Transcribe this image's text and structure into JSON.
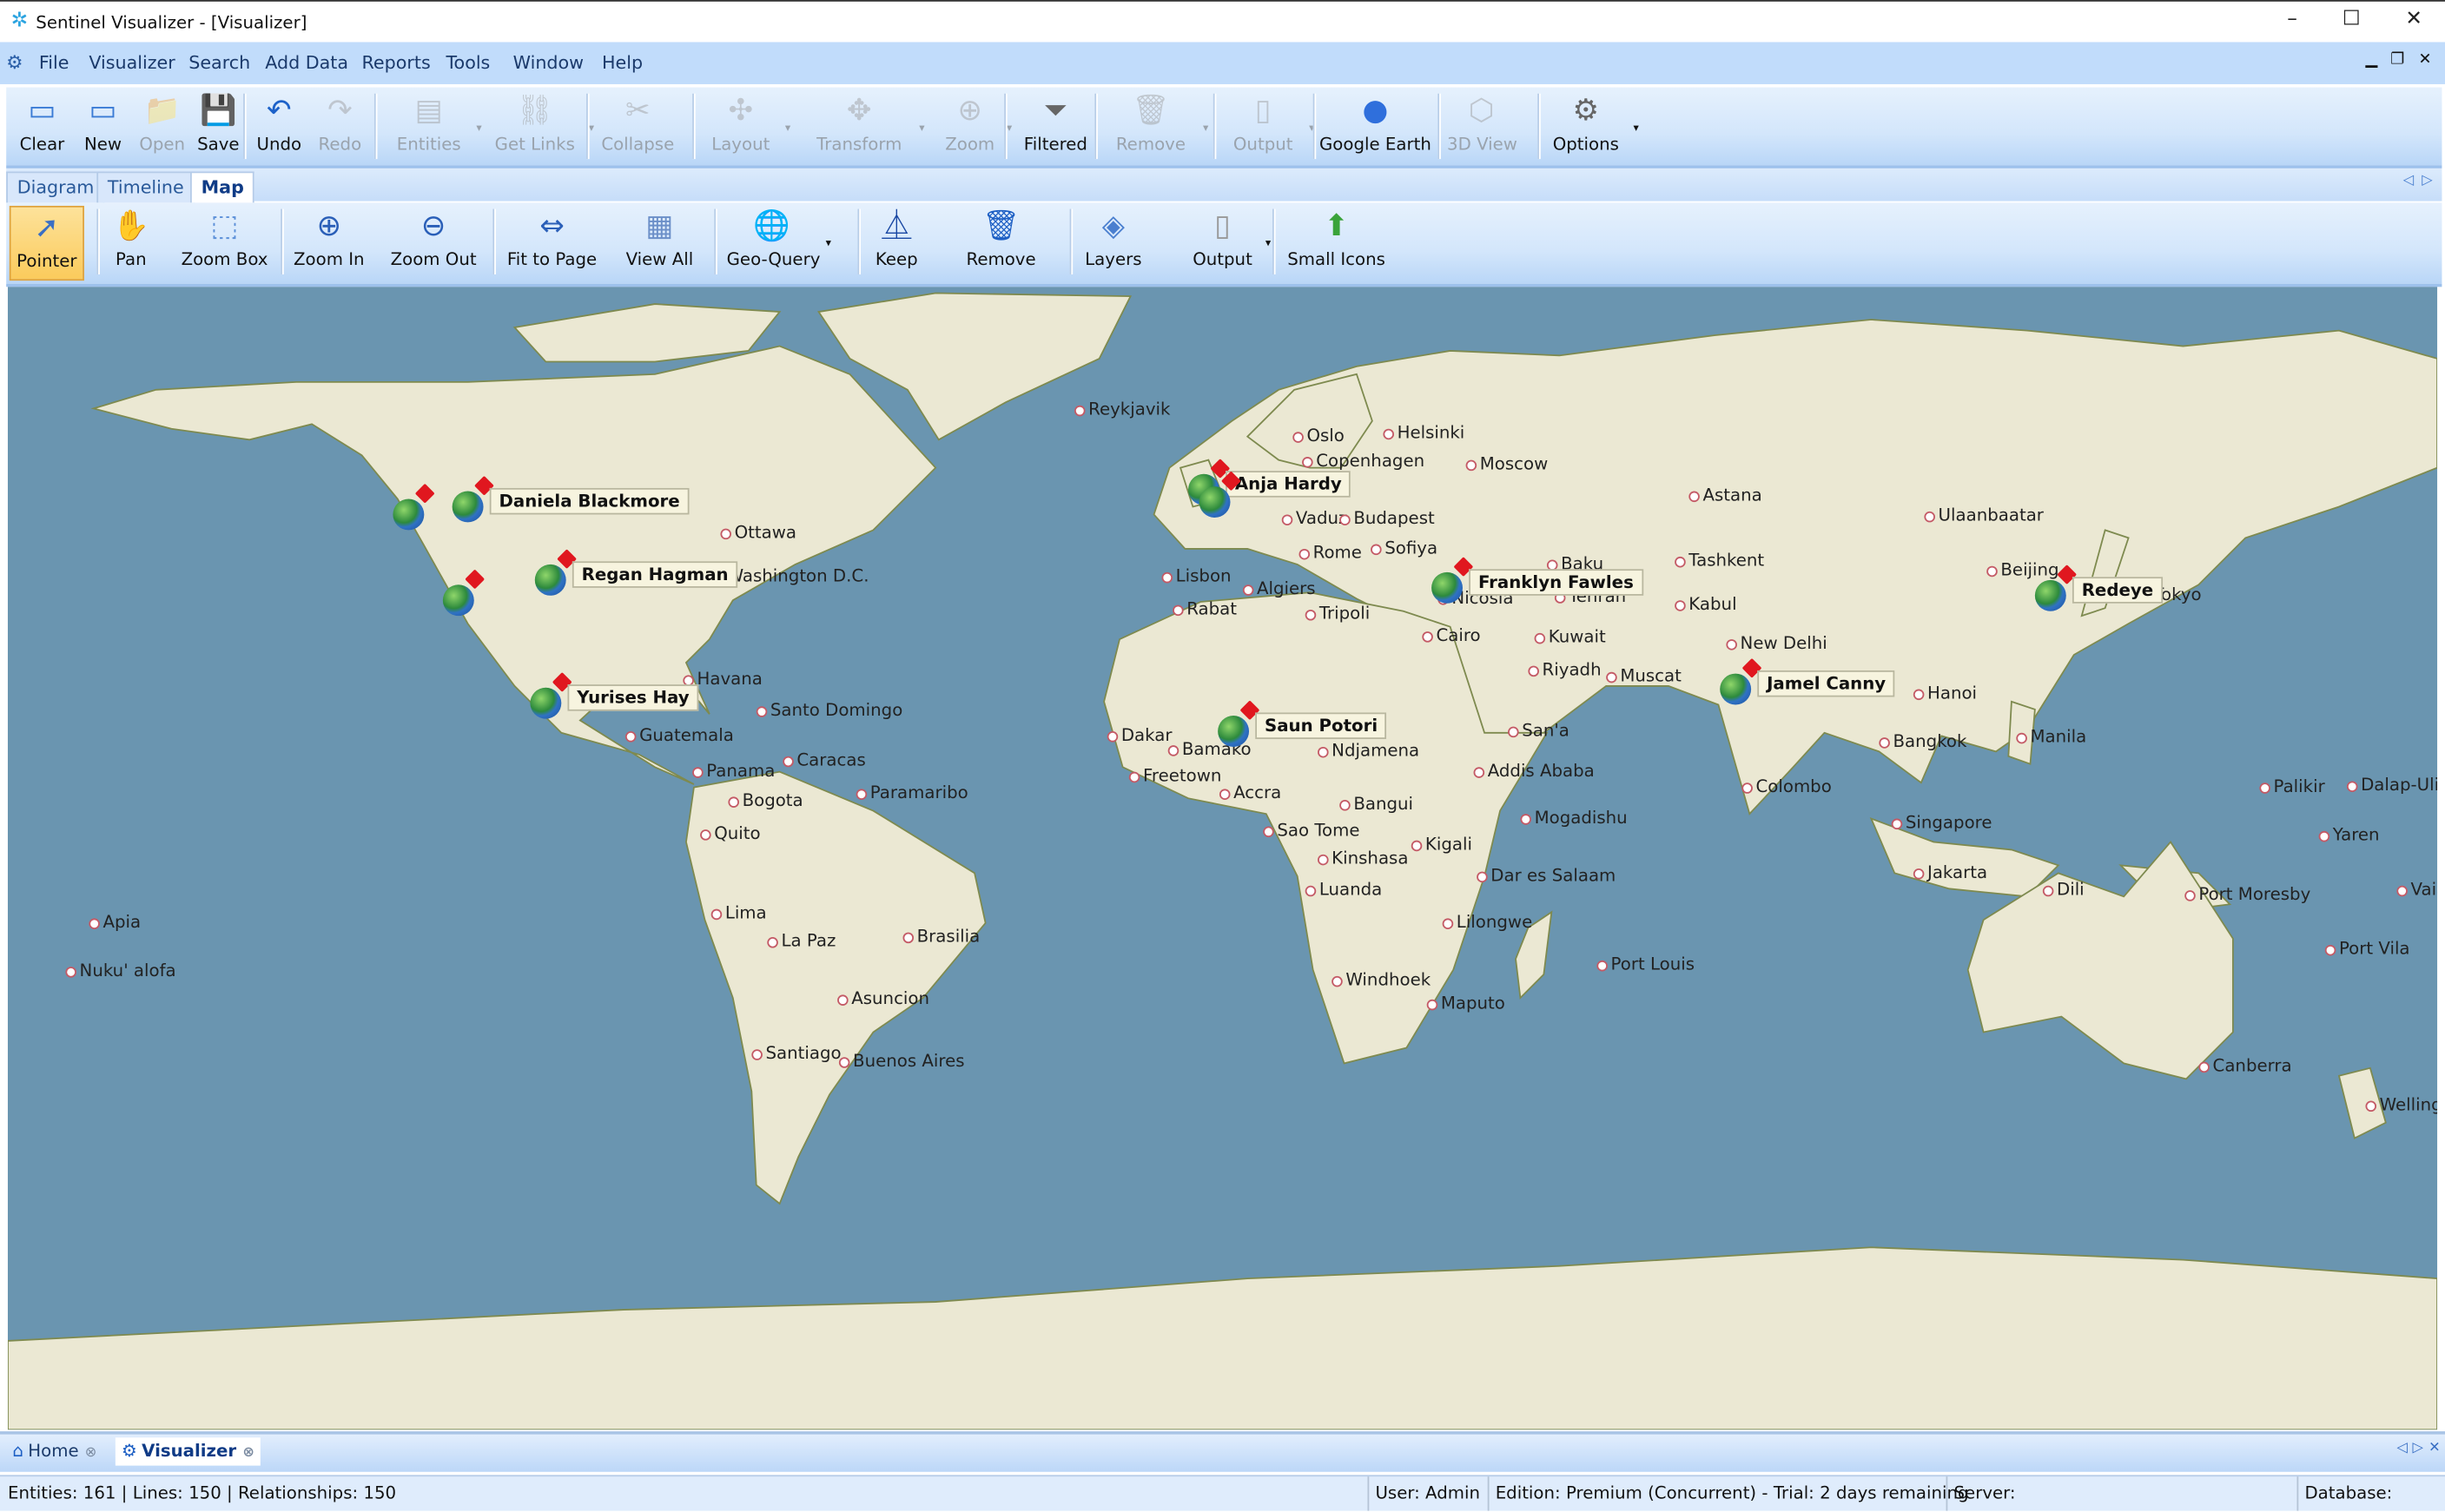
{
  "window": {
    "title": "Sentinel Visualizer - [Visualizer]",
    "app_icon": "sentinel-logo-icon",
    "minimize": "–",
    "maximize": "☐",
    "close": "✕"
  },
  "menu": {
    "items": [
      "File",
      "Visualizer",
      "Search",
      "Add Data",
      "Reports",
      "Tools",
      "Window",
      "Help"
    ],
    "mdi_minimize": "▁",
    "mdi_restore": "❐",
    "mdi_close": "✕"
  },
  "main_toolbar": [
    {
      "label": "Clear",
      "icon": "clear-icon",
      "glyph": "▭",
      "enabled": true,
      "color": "#3a7bd5"
    },
    {
      "label": "New",
      "icon": "new-icon",
      "glyph": "▭",
      "enabled": true,
      "color": "#3a7bd5"
    },
    {
      "label": "Open",
      "icon": "open-folder-icon",
      "glyph": "📁",
      "enabled": false,
      "color": "#999"
    },
    {
      "label": "Save",
      "icon": "save-icon",
      "glyph": "💾",
      "enabled": true,
      "color": "#1746a2"
    },
    {
      "label": "Undo",
      "icon": "undo-icon",
      "glyph": "↶",
      "enabled": true,
      "color": "#1d62c9"
    },
    {
      "label": "Redo",
      "icon": "redo-icon",
      "glyph": "↷",
      "enabled": false,
      "color": "#999"
    },
    {
      "label": "Entities",
      "icon": "entities-icon",
      "glyph": "▤",
      "enabled": false,
      "dropdown": true,
      "color": "#999"
    },
    {
      "label": "Get Links",
      "icon": "get-links-icon",
      "glyph": "⛓",
      "enabled": false,
      "dropdown": true,
      "color": "#999"
    },
    {
      "label": "Collapse",
      "icon": "collapse-icon",
      "glyph": "✂",
      "enabled": false,
      "color": "#999"
    },
    {
      "label": "Layout",
      "icon": "layout-icon",
      "glyph": "✣",
      "enabled": false,
      "dropdown": true,
      "color": "#999"
    },
    {
      "label": "Transform",
      "icon": "transform-icon",
      "glyph": "✥",
      "enabled": false,
      "dropdown": true,
      "color": "#999"
    },
    {
      "label": "Zoom",
      "icon": "zoom-icon",
      "glyph": "⊕",
      "enabled": false,
      "dropdown": true,
      "color": "#999"
    },
    {
      "label": "Filtered",
      "icon": "filter-icon",
      "glyph": "⏷",
      "enabled": true,
      "color": "#666"
    },
    {
      "label": "Remove",
      "icon": "trash-icon",
      "glyph": "🗑",
      "enabled": false,
      "dropdown": true,
      "color": "#999"
    },
    {
      "label": "Output",
      "icon": "output-icon",
      "glyph": "▯",
      "enabled": false,
      "dropdown": true,
      "color": "#999"
    },
    {
      "label": "Google Earth",
      "icon": "google-earth-icon",
      "glyph": "●",
      "enabled": true,
      "color": "#2f6fdc"
    },
    {
      "label": "3D View",
      "icon": "cube-icon",
      "glyph": "⬡",
      "enabled": false,
      "color": "#999"
    },
    {
      "label": "Options",
      "icon": "gear-icon",
      "glyph": "⚙",
      "enabled": true,
      "dropdown": true,
      "color": "#666"
    }
  ],
  "view_tabs": [
    {
      "label": "Diagram",
      "selected": false
    },
    {
      "label": "Timeline",
      "selected": false
    },
    {
      "label": "Map",
      "selected": true
    }
  ],
  "tab_scroll": {
    "left": "◁",
    "right": "▷"
  },
  "map_toolbar": [
    {
      "label": "Pointer",
      "icon": "pointer-icon",
      "glyph": "➚",
      "active": true,
      "color": "#3a6fc4"
    },
    {
      "label": "Pan",
      "icon": "hand-icon",
      "glyph": "✋",
      "color": "#2e5fb0"
    },
    {
      "label": "Zoom Box",
      "icon": "zoom-box-icon",
      "glyph": "⬚",
      "color": "#5b8fd8"
    },
    {
      "label": "Zoom In",
      "icon": "zoom-in-icon",
      "glyph": "⊕",
      "color": "#2a5fb8"
    },
    {
      "label": "Zoom Out",
      "icon": "zoom-out-icon",
      "glyph": "⊖",
      "color": "#2a5fb8"
    },
    {
      "label": "Fit to Page",
      "icon": "fit-to-page-icon",
      "glyph": "⇔",
      "color": "#2a5fb8"
    },
    {
      "label": "View All",
      "icon": "view-all-icon",
      "glyph": "▦",
      "color": "#6b8fc8"
    },
    {
      "label": "Geo-Query",
      "icon": "globe-icon",
      "glyph": "🌐",
      "dropdown": true,
      "color": "#2a5fb8"
    },
    {
      "label": "Keep",
      "icon": "keep-icon",
      "glyph": "⏅",
      "color": "#1746a2"
    },
    {
      "label": "Remove",
      "icon": "trash-icon",
      "glyph": "🗑",
      "color": "#1d5fc4"
    },
    {
      "label": "Layers",
      "icon": "layers-icon",
      "glyph": "◈",
      "color": "#4a7fcf"
    },
    {
      "label": "Output",
      "icon": "output-icon",
      "glyph": "▯",
      "dropdown": true,
      "color": "#999"
    },
    {
      "label": "Small Icons",
      "icon": "small-icons-icon",
      "glyph": "⬆",
      "color": "#3aa33a"
    }
  ],
  "map": {
    "colors": {
      "ocean": "#6a95b0",
      "land": "#ebe8d3",
      "border": "#7e8a4f",
      "city_dot": "#c45a66",
      "pin": "#e0171f"
    },
    "cities": [
      "Reykjavik",
      "Oslo",
      "Helsinki",
      "Copenhagen",
      "Moscow",
      "Astana",
      "Ulaanbaatar",
      "Ottawa",
      "Washington D.C.",
      "Vaduz",
      "Budapest",
      "Rome",
      "Sofiya",
      "Lisbon",
      "Algiers",
      "Rabat",
      "Tripoli",
      "Nicosia",
      "Tehran",
      "Baku",
      "Tashkent",
      "Kabul",
      "Beijing",
      "Tokyo",
      "Kuwait",
      "Cairo",
      "Riyadh",
      "Muscat",
      "New Delhi",
      "Hanoi",
      "Havana",
      "Santo Domingo",
      "Guatemala",
      "Caracas",
      "Panama",
      "Paramaribo",
      "Bogota",
      "Quito",
      "Dakar",
      "Bamako",
      "Ndjamena",
      "Addis Ababa",
      "San'a",
      "Freetown",
      "Accra",
      "Bangui",
      "Mogadishu",
      "Sao Tome",
      "Kinshasa",
      "Kigali",
      "Luanda",
      "Dar es Salaam",
      "Lilongwe",
      "Windhoek",
      "Maputo",
      "Port Louis",
      "Lima",
      "La Paz",
      "Brasilia",
      "Asuncion",
      "Santiago",
      "Buenos Aires",
      "Apia",
      "Nuku' alofa",
      "Colombo",
      "Bangkok",
      "Manila",
      "Singapore",
      "Jakarta",
      "Dili",
      "Port Moresby",
      "Palikir",
      "Yaren",
      "Dalap-Uliga",
      "Port Vila",
      "Canberra",
      "Wellington",
      "Vaiaku"
    ],
    "entities": [
      {
        "name": "Daniela Blackmore"
      },
      {
        "name": ""
      },
      {
        "name": "Regan Hagman"
      },
      {
        "name": ""
      },
      {
        "name": "Yurises Hay"
      },
      {
        "name": "Anja Hardy"
      },
      {
        "name": ""
      },
      {
        "name": "Franklyn Fawles"
      },
      {
        "name": "Redeye"
      },
      {
        "name": "Jamel Canny"
      },
      {
        "name": "Saun Potori"
      }
    ]
  },
  "doc_tabs": [
    {
      "label": "Home",
      "icon": "home-icon"
    },
    {
      "label": "Visualizer",
      "icon": "visualizer-icon",
      "selected": true
    }
  ],
  "doc_tab_controls": {
    "left": "◁",
    "right": "▷",
    "close": "✕"
  },
  "status": {
    "counts": "Entities: 161 | Lines: 150 | Relationships: 150",
    "user": "User:  Admin",
    "edition": "Edition: Premium (Concurrent) - Trial: 2 days remaining",
    "server": "Server:",
    "database": "Database:"
  }
}
